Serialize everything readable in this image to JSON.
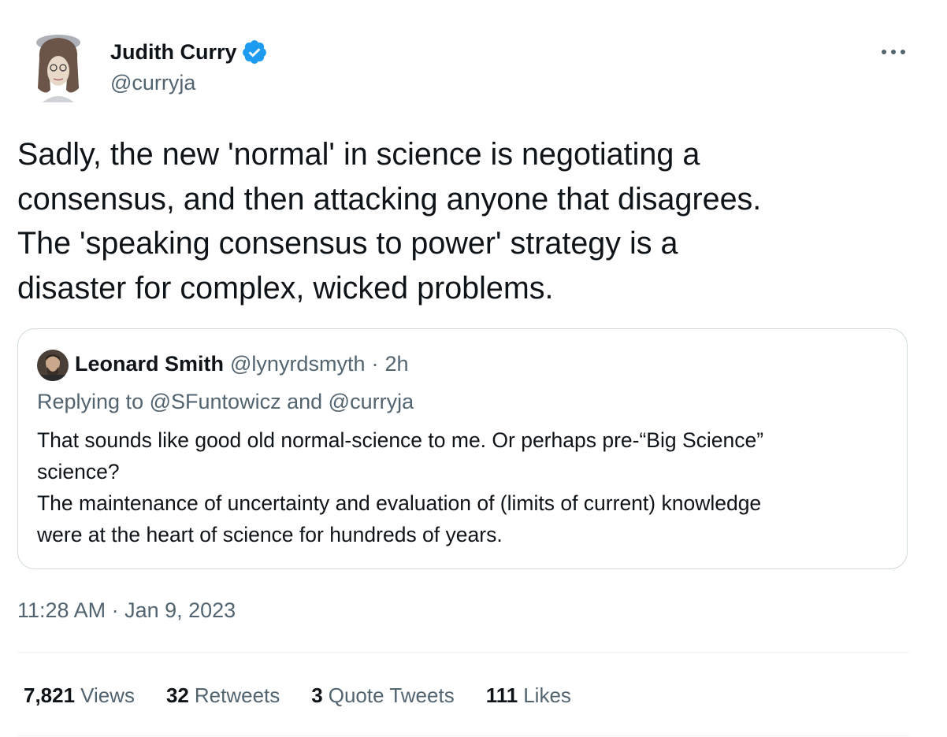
{
  "author": {
    "name": "Judith Curry",
    "handle": "@curryja",
    "verified_icon": "verified-badge-icon",
    "verified_color": "#1d9bf0"
  },
  "tweet": {
    "text": "Sadly, the new 'normal' in science is negotiating a\nconsensus, and then attacking anyone that disagrees.\nThe 'speaking consensus to power' strategy is a\ndisaster for complex, wicked problems.",
    "timestamp": "11:28 AM · Jan 9, 2023"
  },
  "quoted_tweet": {
    "name": "Leonard Smith",
    "handle": "@lynyrdsmyth",
    "separator": "·",
    "time": "2h",
    "replying_prefix": "Replying to",
    "replying_mention_1": "@SFuntowicz",
    "replying_and": "and",
    "replying_mention_2": "@curryja",
    "text": "That sounds like good old normal-science to me. Or perhaps pre-“Big Science”\nscience?\nThe maintenance of uncertainty and evaluation of (limits of current) knowledge\nwere at the heart of science for hundreds of years."
  },
  "stats": {
    "views_count": "7,821",
    "views_label": "Views",
    "retweets_count": "32",
    "retweets_label": "Retweets",
    "quotes_count": "3",
    "quotes_label": "Quote Tweets",
    "likes_count": "111",
    "likes_label": "Likes"
  },
  "icons": {
    "more": "more-horizontal-icon"
  },
  "colors": {
    "text_primary": "#0f1419",
    "text_secondary": "#536471",
    "border": "#cfd9de",
    "divider": "#eff3f4",
    "accent": "#1d9bf0"
  }
}
